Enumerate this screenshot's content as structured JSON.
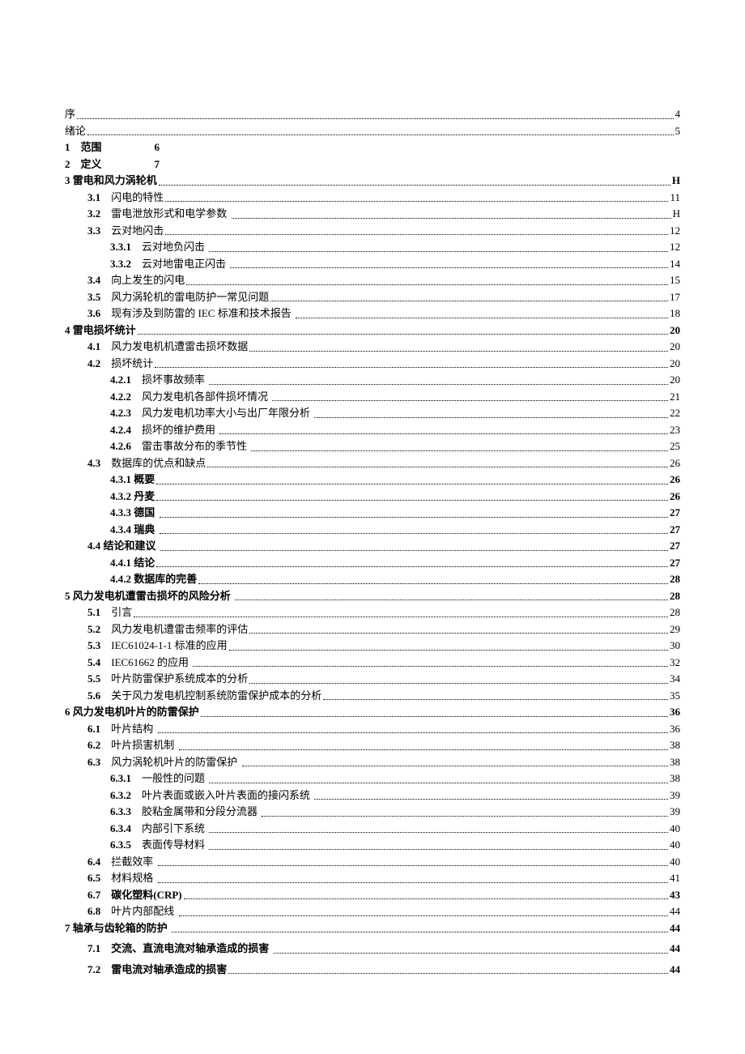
{
  "toc": [
    {
      "indent": 0,
      "num": "",
      "title": "序",
      "page": "4",
      "bold": false,
      "dots": true
    },
    {
      "indent": 0,
      "num": "",
      "title": "绪论",
      "page": "5",
      "bold": false,
      "dots": true
    },
    {
      "indent": 0,
      "num": "1",
      "title": "    范围                    6",
      "page": "",
      "bold": true,
      "dots": false
    },
    {
      "indent": 0,
      "num": "2",
      "title": "    定义                    7",
      "page": "",
      "bold": true,
      "dots": false
    },
    {
      "indent": 0,
      "num": "3",
      "title": " 雷电和风力涡轮机",
      "page": "H",
      "bold": true,
      "dots": true
    },
    {
      "indent": 1,
      "num": "3.1",
      "title": "    闪电的特性",
      "page": "11",
      "bold": false,
      "dots": true,
      "numBold": true
    },
    {
      "indent": 1,
      "num": "3.2",
      "title": "    雷电泄放形式和电学参数 ",
      "page": "H",
      "bold": false,
      "dots": true,
      "numBold": true
    },
    {
      "indent": 1,
      "num": "3.3",
      "title": "    云对地闪击",
      "page": "12",
      "bold": false,
      "dots": true,
      "numBold": true
    },
    {
      "indent": 2,
      "num": "3.3.1",
      "title": "    云对地负闪击 ",
      "page": "12",
      "bold": false,
      "dots": true,
      "numBold": true
    },
    {
      "indent": 2,
      "num": "3.3.2",
      "title": "    云对地雷电正闪击 ",
      "page": "14",
      "bold": false,
      "dots": true,
      "numBold": true
    },
    {
      "indent": 1,
      "num": "3.4",
      "title": "    向上发生的闪电",
      "page": "15",
      "bold": false,
      "dots": true,
      "numBold": true
    },
    {
      "indent": 1,
      "num": "3.5",
      "title": "    风力涡轮机的雷电防护一常见问题",
      "page": "17",
      "bold": false,
      "dots": true,
      "numBold": true
    },
    {
      "indent": 1,
      "num": "3.6",
      "title": "    现有涉及到防雷的 IEC 标准和技术报告 ",
      "page": "18",
      "bold": false,
      "dots": true,
      "numBold": true
    },
    {
      "indent": 0,
      "num": "4",
      "title": " 雷电损坏统计",
      "page": "20",
      "bold": true,
      "dots": true
    },
    {
      "indent": 1,
      "num": "4.1",
      "title": "    风力发电机机遭雷击损坏数据",
      "page": "20",
      "bold": false,
      "dots": true,
      "numBold": true
    },
    {
      "indent": 1,
      "num": "4.2",
      "title": "    损坏统计",
      "page": "20",
      "bold": false,
      "dots": true,
      "numBold": true
    },
    {
      "indent": 2,
      "num": "4.2.1",
      "title": "    损坏事故频率 ",
      "page": "20",
      "bold": false,
      "dots": true,
      "numBold": true
    },
    {
      "indent": 2,
      "num": "4.2.2",
      "title": "    风力发电机各部件损坏情况 ",
      "page": "21",
      "bold": false,
      "dots": true,
      "numBold": true
    },
    {
      "indent": 2,
      "num": "4.2.3",
      "title": "    风力发电机功率大小与出厂年限分析 ",
      "page": "22",
      "bold": false,
      "dots": true,
      "numBold": true
    },
    {
      "indent": 2,
      "num": "4.2.4",
      "title": "    损坏的维护费用 ",
      "page": "23",
      "bold": false,
      "dots": true,
      "numBold": true
    },
    {
      "indent": 2,
      "num": "4.2.6",
      "title": "    雷击事故分布的季节性 ",
      "page": "25",
      "bold": false,
      "dots": true,
      "numBold": true
    },
    {
      "indent": 1,
      "num": "4.3",
      "title": "    数据库的优点和缺点",
      "page": "26",
      "bold": false,
      "dots": true,
      "numBold": true
    },
    {
      "indent": 2,
      "num": "4.3.1",
      "title": " 概要",
      "page": "26",
      "bold": true,
      "dots": true
    },
    {
      "indent": 2,
      "num": "4.3.2",
      "title": " 丹麦",
      "page": "26",
      "bold": true,
      "dots": true
    },
    {
      "indent": 2,
      "num": "4.3.3",
      "title": " 德国 ",
      "page": "27",
      "bold": true,
      "dots": true
    },
    {
      "indent": 2,
      "num": "4.3.4",
      "title": " 瑞典 ",
      "page": "27",
      "bold": true,
      "dots": true
    },
    {
      "indent": 1,
      "num": "4.4",
      "title": " 结论和建议 ",
      "page": "27",
      "bold": true,
      "dots": true
    },
    {
      "indent": 2,
      "num": "4.4.1",
      "title": " 结论",
      "page": "27",
      "bold": true,
      "dots": true
    },
    {
      "indent": 2,
      "num": "4.4.2",
      "title": " 数据库的完善",
      "page": "28",
      "bold": true,
      "dots": true
    },
    {
      "indent": 0,
      "num": "5",
      "title": " 风力发电机遭雷击损坏的风险分析 ",
      "page": "28",
      "bold": true,
      "dots": true
    },
    {
      "indent": 1,
      "num": "5.1",
      "title": "    引言",
      "page": "28",
      "bold": false,
      "dots": true,
      "numBold": true
    },
    {
      "indent": 1,
      "num": "5.2",
      "title": "    风力发电机遭雷击频率的评估",
      "page": "29",
      "bold": false,
      "dots": true,
      "numBold": true
    },
    {
      "indent": 1,
      "num": "5.3",
      "title": "    IEC61024-1-1 标准的应用",
      "page": "30",
      "bold": false,
      "dots": true,
      "numBold": true
    },
    {
      "indent": 1,
      "num": "5.4",
      "title": "    IEC61662 的应用 ",
      "page": "32",
      "bold": false,
      "dots": true,
      "numBold": true
    },
    {
      "indent": 1,
      "num": "5.5",
      "title": "    叶片防雷保护系统成本的分析",
      "page": "34",
      "bold": false,
      "dots": true,
      "numBold": true
    },
    {
      "indent": 1,
      "num": "5.6",
      "title": "    关于风力发电机控制系统防雷保护成本的分析",
      "page": "35",
      "bold": false,
      "dots": true,
      "numBold": true
    },
    {
      "indent": 0,
      "num": "6",
      "title": " 风力发电机叶片的防雷保护",
      "page": "36",
      "bold": true,
      "dots": true
    },
    {
      "indent": 1,
      "num": "6.1",
      "title": "    叶片结构 ",
      "page": "36",
      "bold": false,
      "dots": true,
      "numBold": true
    },
    {
      "indent": 1,
      "num": "6.2",
      "title": "    叶片损害机制 ",
      "page": "38",
      "bold": false,
      "dots": true,
      "numBold": true
    },
    {
      "indent": 1,
      "num": "6.3",
      "title": "    风力涡轮机叶片的防雷保护 ",
      "page": "38",
      "bold": false,
      "dots": true,
      "numBold": true
    },
    {
      "indent": 2,
      "num": "6.3.1",
      "title": "    一般性的问题 ",
      "page": "38",
      "bold": false,
      "dots": true,
      "numBold": true
    },
    {
      "indent": 2,
      "num": "6.3.2",
      "title": "    叶片表面或嵌入叶片表面的接闪系统 ",
      "page": "39",
      "bold": false,
      "dots": true,
      "numBold": true
    },
    {
      "indent": 2,
      "num": "6.3.3",
      "title": "    胶粘金属带和分段分流器 ",
      "page": "39",
      "bold": false,
      "dots": true,
      "numBold": true
    },
    {
      "indent": 2,
      "num": "6.3.4",
      "title": "    内部引下系统 ",
      "page": "40",
      "bold": false,
      "dots": true,
      "numBold": true
    },
    {
      "indent": 2,
      "num": "6.3.5",
      "title": "    表面传导材料 ",
      "page": "40",
      "bold": false,
      "dots": true,
      "numBold": true
    },
    {
      "indent": 1,
      "num": "6.4",
      "title": "    拦截效率 ",
      "page": "40",
      "bold": false,
      "dots": true,
      "numBold": true
    },
    {
      "indent": 1,
      "num": "6.5",
      "title": "    材料规格 ",
      "page": "41",
      "bold": false,
      "dots": true,
      "numBold": true
    },
    {
      "indent": 1,
      "num": "6.7",
      "title": "    碳化塑料(CRP)",
      "page": "43",
      "bold": true,
      "dots": true,
      "numBold": true
    },
    {
      "indent": 1,
      "num": "6.8",
      "title": "    叶片内部配线 ",
      "page": "44",
      "bold": false,
      "dots": true,
      "numBold": true
    },
    {
      "indent": 0,
      "num": "7",
      "title": " 轴承与齿轮箱的防护 ",
      "page": "44",
      "bold": true,
      "dots": true
    },
    {
      "indent": 1,
      "num": "7.1",
      "title": "    交流、直流电流对轴承造成的损害 ",
      "page": "44",
      "bold": true,
      "dots": true,
      "numBold": true,
      "extra": true
    },
    {
      "indent": 1,
      "num": "7.2",
      "title": "    雷电流对轴承造成的损害",
      "page": "44",
      "bold": true,
      "dots": true,
      "numBold": true,
      "extra": true
    }
  ]
}
